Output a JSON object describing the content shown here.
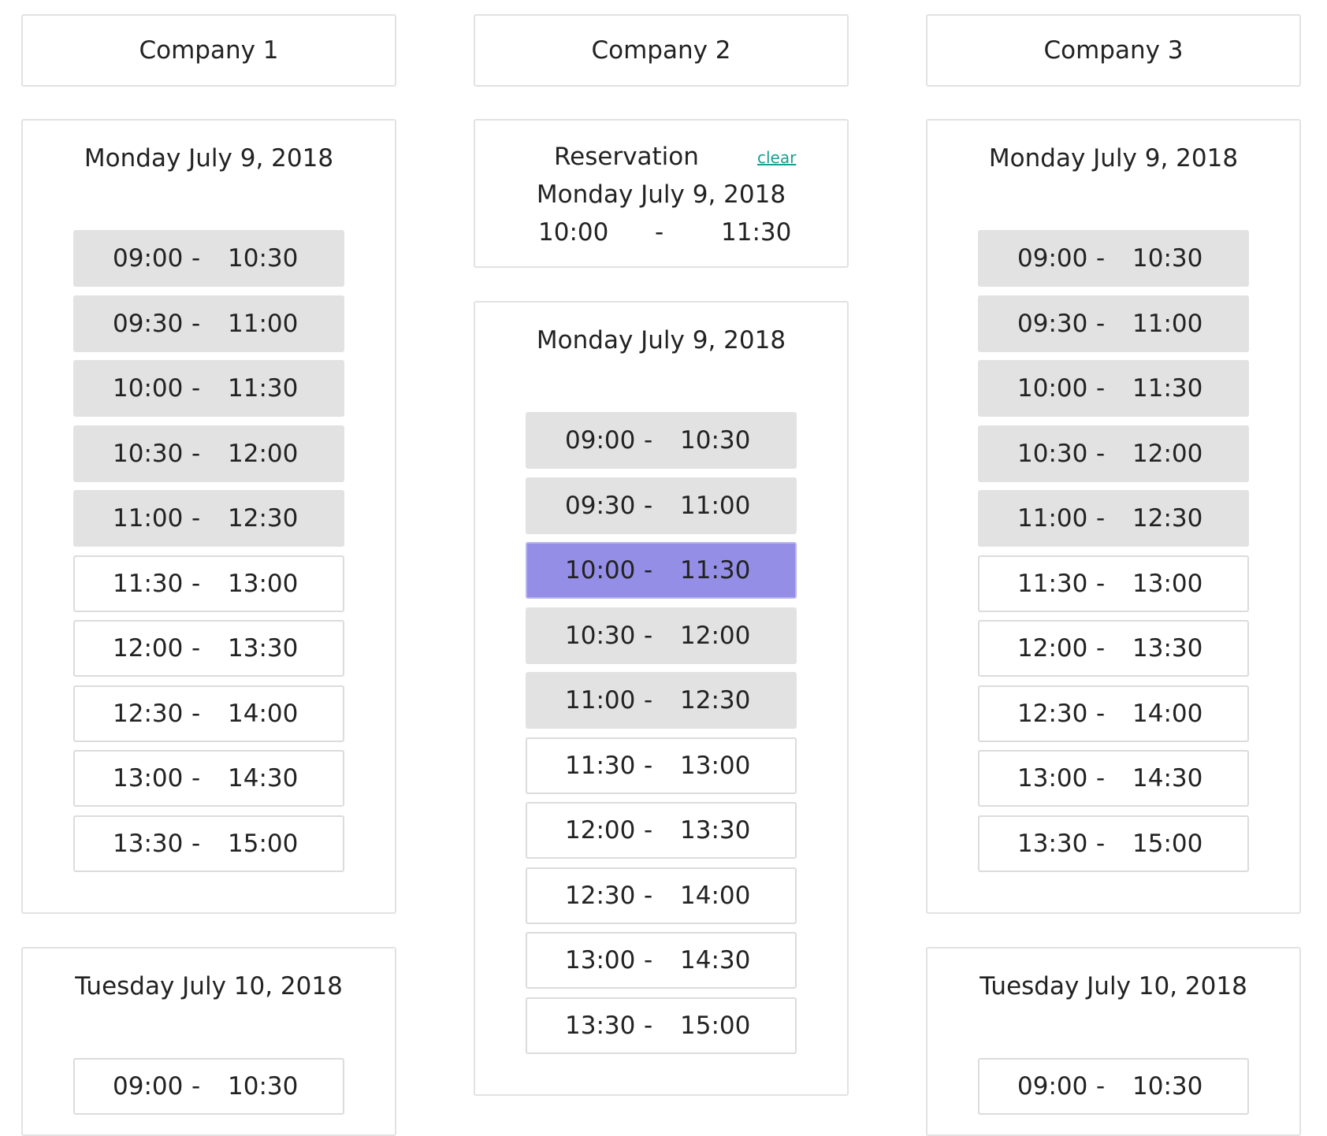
{
  "companies": [
    {
      "name": "Company 1",
      "days": [
        {
          "date": "Monday July 9, 2018",
          "slots": [
            {
              "start": "09:00",
              "end": "10:30",
              "status": "booked"
            },
            {
              "start": "09:30",
              "end": "11:00",
              "status": "booked"
            },
            {
              "start": "10:00",
              "end": "11:30",
              "status": "booked"
            },
            {
              "start": "10:30",
              "end": "12:00",
              "status": "booked"
            },
            {
              "start": "11:00",
              "end": "12:30",
              "status": "booked"
            },
            {
              "start": "11:30",
              "end": "13:00",
              "status": "available"
            },
            {
              "start": "12:00",
              "end": "13:30",
              "status": "available"
            },
            {
              "start": "12:30",
              "end": "14:00",
              "status": "available"
            },
            {
              "start": "13:00",
              "end": "14:30",
              "status": "available"
            },
            {
              "start": "13:30",
              "end": "15:00",
              "status": "available"
            }
          ]
        },
        {
          "date": "Tuesday July 10, 2018",
          "slots": [
            {
              "start": "09:00",
              "end": "10:30",
              "status": "available"
            }
          ]
        }
      ]
    },
    {
      "name": "Company 2",
      "reservation": {
        "label": "Reservation",
        "clear_label": "clear",
        "date": "Monday July 9, 2018",
        "start": "10:00",
        "end": "11:30"
      },
      "days": [
        {
          "date": "Monday July 9, 2018",
          "slots": [
            {
              "start": "09:00",
              "end": "10:30",
              "status": "booked"
            },
            {
              "start": "09:30",
              "end": "11:00",
              "status": "booked"
            },
            {
              "start": "10:00",
              "end": "11:30",
              "status": "selected"
            },
            {
              "start": "10:30",
              "end": "12:00",
              "status": "booked"
            },
            {
              "start": "11:00",
              "end": "12:30",
              "status": "booked"
            },
            {
              "start": "11:30",
              "end": "13:00",
              "status": "available"
            },
            {
              "start": "12:00",
              "end": "13:30",
              "status": "available"
            },
            {
              "start": "12:30",
              "end": "14:00",
              "status": "available"
            },
            {
              "start": "13:00",
              "end": "14:30",
              "status": "available"
            },
            {
              "start": "13:30",
              "end": "15:00",
              "status": "available"
            }
          ]
        }
      ]
    },
    {
      "name": "Company 3",
      "days": [
        {
          "date": "Monday July 9, 2018",
          "slots": [
            {
              "start": "09:00",
              "end": "10:30",
              "status": "booked"
            },
            {
              "start": "09:30",
              "end": "11:00",
              "status": "booked"
            },
            {
              "start": "10:00",
              "end": "11:30",
              "status": "booked"
            },
            {
              "start": "10:30",
              "end": "12:00",
              "status": "booked"
            },
            {
              "start": "11:00",
              "end": "12:30",
              "status": "booked"
            },
            {
              "start": "11:30",
              "end": "13:00",
              "status": "available"
            },
            {
              "start": "12:00",
              "end": "13:30",
              "status": "available"
            },
            {
              "start": "12:30",
              "end": "14:00",
              "status": "available"
            },
            {
              "start": "13:00",
              "end": "14:30",
              "status": "available"
            },
            {
              "start": "13:30",
              "end": "15:00",
              "status": "available"
            }
          ]
        },
        {
          "date": "Tuesday July 10, 2018",
          "slots": [
            {
              "start": "09:00",
              "end": "10:30",
              "status": "available"
            }
          ]
        }
      ]
    }
  ],
  "colors": {
    "booked": "#e2e2e2",
    "selected": "#948ee6",
    "link": "#1a9e93",
    "border": "#e2e2e2"
  }
}
